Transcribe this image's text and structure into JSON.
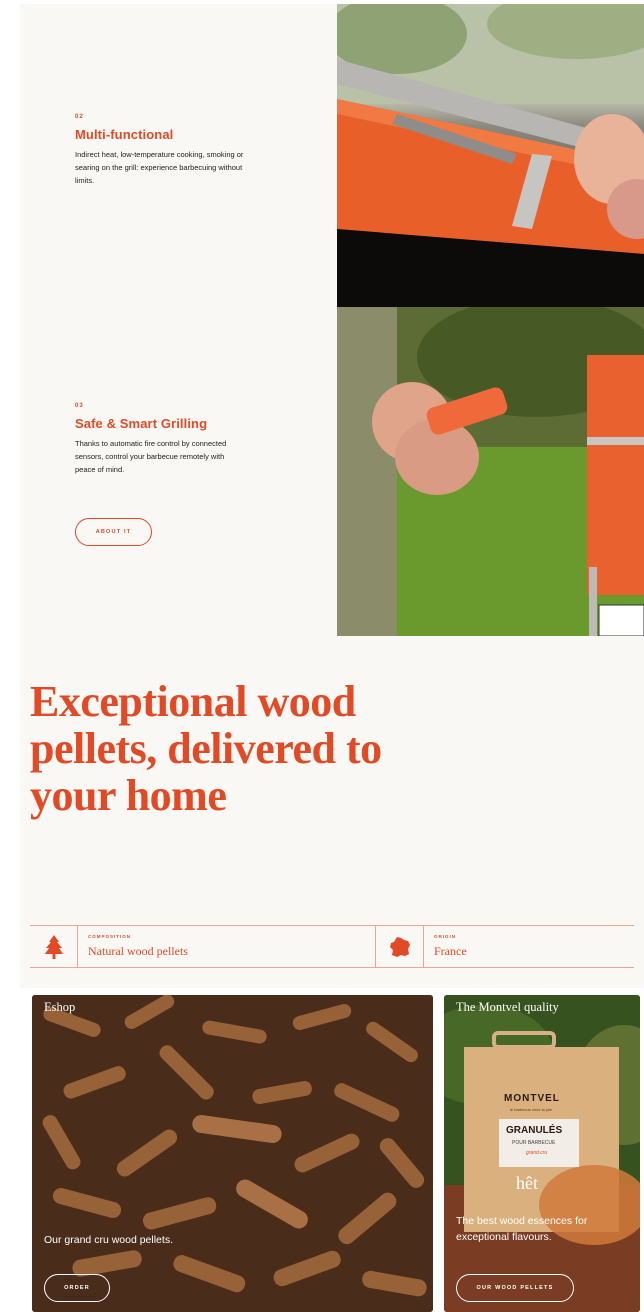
{
  "features": [
    {
      "num": "02",
      "title": "Multi-functional",
      "desc": "Indirect heat, low-temperature cooking, smoking or searing on the grill: experience barbecuing without limits."
    },
    {
      "num": "03",
      "title": "Safe & Smart Grilling",
      "desc": "Thanks to automatic fire control by connected sensors, control your barbecue remotely with peace of mind."
    }
  ],
  "about_button": "ABOUT IT",
  "pellets": {
    "headline": "Exceptional wood pellets, delivered to your home",
    "composition_label": "COMPOSITION",
    "composition_value": "Natural wood pellets",
    "origin_label": "ORIGIN",
    "origin_value": "France"
  },
  "cards": [
    {
      "title": "Eshop",
      "caption": "Our grand cru wood pellets.",
      "button": "ORDER"
    },
    {
      "title": "The Montvel quality",
      "caption": "The best wood essences for exceptional flavours.",
      "button": "OUR WOOD PELLETS"
    }
  ],
  "box": {
    "brand": "MONTVEL",
    "tagline": "le barbecue chez la joie",
    "product": "GRANULÉS",
    "sub": "POUR BARBECUE",
    "note": "grand cru",
    "wood": "hêt"
  },
  "colors": {
    "accent": "#e24a26",
    "background": "#faf8f4"
  },
  "icons": {
    "tree": "tree-icon",
    "france": "france-map-icon"
  }
}
